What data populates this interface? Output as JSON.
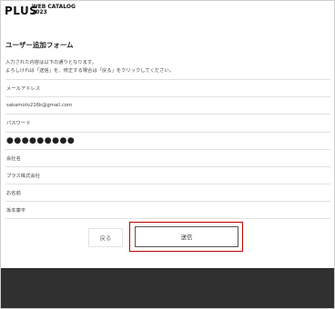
{
  "header": {
    "logo_main": "PLUS",
    "logo_sub_line1": "WEB CATALOG",
    "logo_sub_line2": "2023"
  },
  "form": {
    "title": "ユーザー追加フォーム",
    "description_line1": "入力された内容は以下の通りとなります。",
    "description_line2": "よろしければ「送信」を、修正する場合は「戻る」をクリックしてください。",
    "rows": [
      "メールアドレス",
      "sakamoto216k@gmail.com",
      "パスワード",
      "●●●●●●●●●",
      "会社名",
      "プラス株式会社",
      "お名前",
      "坂本康平"
    ]
  },
  "actions": {
    "back_label": "戻る",
    "send_label": "送信"
  },
  "colors": {
    "highlight": "#c00000",
    "footer": "#303030"
  }
}
